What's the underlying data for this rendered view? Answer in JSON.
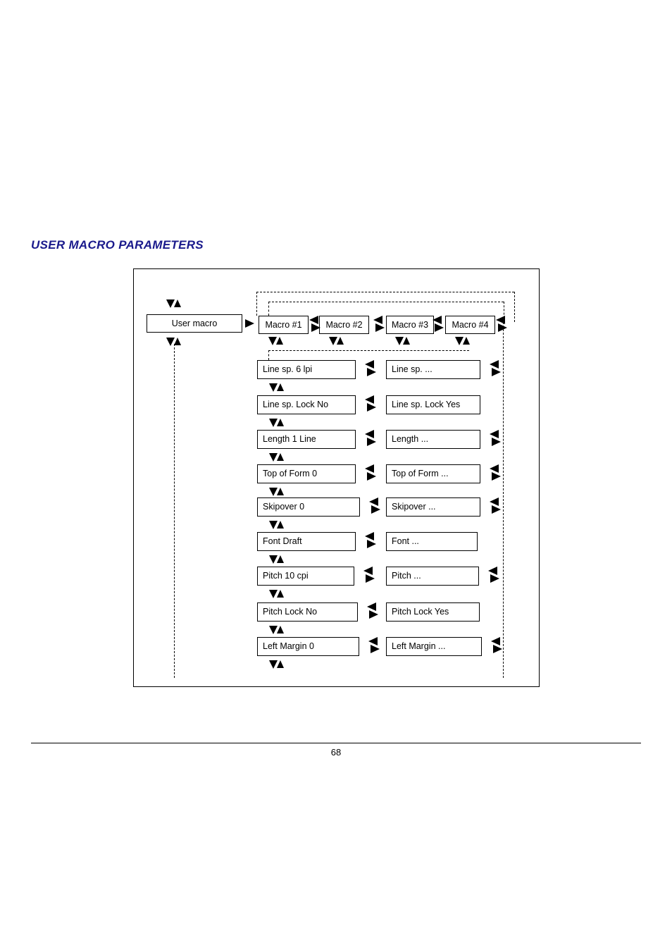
{
  "page": {
    "section_title": "USER MACRO PARAMETERS",
    "page_number": "68"
  },
  "diagram": {
    "entry": {
      "label": "User macro"
    },
    "macros": [
      {
        "label": "Macro #1"
      },
      {
        "label": "Macro #2"
      },
      {
        "label": "Macro #3"
      },
      {
        "label": "Macro #4"
      }
    ],
    "parameters": [
      {
        "default": "Line sp. 6 lpi",
        "alternate": "Line sp. ...",
        "alt_has_toggle": true
      },
      {
        "default": "Line sp. Lock No",
        "alternate": "Line sp. Lock Yes",
        "alt_has_toggle": false
      },
      {
        "default": "Length 1 Line",
        "alternate": "Length ...",
        "alt_has_toggle": true
      },
      {
        "default": "Top of Form 0",
        "alternate": "Top of Form ...",
        "alt_has_toggle": true
      },
      {
        "default": "Skipover 0",
        "alternate": "Skipover ...",
        "alt_has_toggle": true
      },
      {
        "default": "Font Draft",
        "alternate": "Font ...",
        "alt_has_toggle": false
      },
      {
        "default": "Pitch 10 cpi",
        "alternate": "Pitch ...",
        "alt_has_toggle": true
      },
      {
        "default": "Pitch Lock No",
        "alternate": "Pitch Lock Yes",
        "alt_has_toggle": false
      },
      {
        "default": "Left Margin 0",
        "alternate": "Left Margin ...",
        "alt_has_toggle": true
      }
    ],
    "icons": {
      "scroll_vertical": "down-up-arrow-pair-icon",
      "toggle_horizontal": "left-right-arrow-pair-icon",
      "enter": "right-arrow-icon"
    },
    "colors": {
      "line": "#000000",
      "title": "#1a1a8c",
      "background": "#ffffff"
    }
  }
}
